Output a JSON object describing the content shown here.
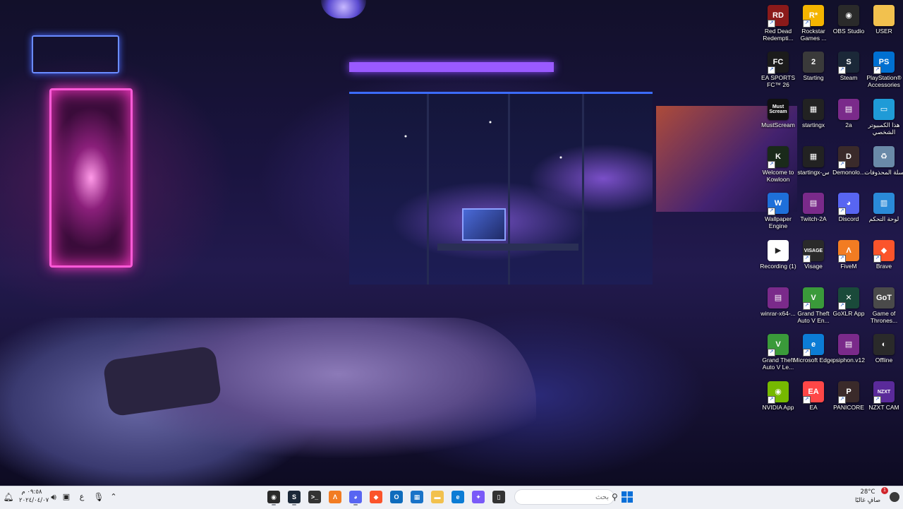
{
  "desktop": {
    "icons": [
      {
        "name": "red-dead-redemption-icon",
        "label": "Red Dead Redempti...",
        "glyph": "RD",
        "color": "#8b1a1a",
        "shortcut": true
      },
      {
        "name": "rockstar-games-icon",
        "label": "Rockstar Games ...",
        "glyph": "R*",
        "color": "#f4b400",
        "shortcut": true
      },
      {
        "name": "obs-studio-icon",
        "label": "OBS Studio",
        "glyph": "◉",
        "color": "#2a2a2a",
        "shortcut": false
      },
      {
        "name": "user-folder-icon",
        "label": "USER",
        "glyph": "",
        "color": "#f2c14e",
        "shortcut": false
      },
      {
        "name": "ea-sports-fc-icon",
        "label": "EA SPORTS FC™ 26",
        "glyph": "FC",
        "color": "#1b1b1b",
        "shortcut": true
      },
      {
        "name": "starting-icon",
        "label": "Starting",
        "glyph": "2",
        "color": "#3a3a3a",
        "shortcut": false
      },
      {
        "name": "steam-icon",
        "label": "Steam",
        "glyph": "S",
        "color": "#1b2838",
        "shortcut": true
      },
      {
        "name": "playstation-accessories-icon",
        "label": "PlayStation® Accessories",
        "glyph": "PS",
        "color": "#0070d1",
        "shortcut": true
      },
      {
        "name": "mustscream-icon",
        "label": "MustScream",
        "glyph": "Must Scream",
        "color": "#111111",
        "shortcut": false
      },
      {
        "name": "startingx-icon",
        "label": "startingx",
        "glyph": "▦",
        "color": "#222222",
        "shortcut": false
      },
      {
        "name": "2a-archive-icon",
        "label": "2a",
        "glyph": "▤",
        "color": "#7a2a8a",
        "shortcut": false
      },
      {
        "name": "this-pc-icon",
        "label": "هذا الكمبيوتر الشخصي",
        "glyph": "▭",
        "color": "#1f9bd7",
        "shortcut": false
      },
      {
        "name": "welcome-to-kowloon-icon",
        "label": "Welcome to Kowloon",
        "glyph": "K",
        "color": "#1a2a1a",
        "shortcut": true
      },
      {
        "name": "startingx-2-icon",
        "label": "startingx-س",
        "glyph": "▦",
        "color": "#222222",
        "shortcut": false
      },
      {
        "name": "demonologist-icon",
        "label": "Demonolo...",
        "glyph": "D",
        "color": "#3a2a2a",
        "shortcut": true
      },
      {
        "name": "recycle-bin-icon",
        "label": "سلة المحذوفات",
        "glyph": "♻",
        "color": "#6a8aa8",
        "shortcut": false
      },
      {
        "name": "wallpaper-engine-icon",
        "label": "Wallpaper Engine",
        "glyph": "W",
        "color": "#1e6fd9",
        "shortcut": true
      },
      {
        "name": "twitch-2a-icon",
        "label": "Twitch-2A",
        "glyph": "▤",
        "color": "#7a2a8a",
        "shortcut": false
      },
      {
        "name": "discord-icon",
        "label": "Discord",
        "glyph": "◕",
        "color": "#5865f2",
        "shortcut": true
      },
      {
        "name": "control-panel-icon",
        "label": "لوحة التحكم",
        "glyph": "▥",
        "color": "#2a8ad8",
        "shortcut": false
      },
      {
        "name": "recording-icon",
        "label": "Recording (1)",
        "glyph": "▶",
        "color": "#ffffff",
        "shortcut": false
      },
      {
        "name": "visage-icon",
        "label": "Visage",
        "glyph": "VISAGE",
        "color": "#2a2a2a",
        "shortcut": true
      },
      {
        "name": "fivem-icon",
        "label": "FiveM",
        "glyph": "Λ",
        "color": "#f27c22",
        "shortcut": true
      },
      {
        "name": "brave-icon",
        "label": "Brave",
        "glyph": "◆",
        "color": "#fb542b",
        "shortcut": true
      },
      {
        "name": "winrar-icon",
        "label": "winrar-x64-...",
        "glyph": "▤",
        "color": "#7a2a8a",
        "shortcut": false
      },
      {
        "name": "gta-v-enhanced-icon",
        "label": "Grand Theft Auto V En...",
        "glyph": "V",
        "color": "#3a9a3a",
        "shortcut": true
      },
      {
        "name": "goxlr-app-icon",
        "label": "GoXLR App",
        "glyph": "✕",
        "color": "#1a4a3a",
        "shortcut": true
      },
      {
        "name": "game-of-thrones-icon",
        "label": "Game of Thrones...",
        "glyph": "GoT",
        "color": "#4a4a4a",
        "shortcut": false
      },
      {
        "name": "gta-v-legacy-icon",
        "label": "Grand Theft Auto V Le...",
        "glyph": "V",
        "color": "#3a9a3a",
        "shortcut": true
      },
      {
        "name": "microsoft-edge-icon",
        "label": "Microsoft Edge",
        "glyph": "e",
        "color": "#0c7cd5",
        "shortcut": true
      },
      {
        "name": "psiphon-icon",
        "label": "psiphon.v12",
        "glyph": "▤",
        "color": "#7a2a8a",
        "shortcut": false
      },
      {
        "name": "offline-icon",
        "label": "Offline",
        "glyph": "◐",
        "color": "#2a2a2a",
        "shortcut": false
      },
      {
        "name": "nvidia-app-icon",
        "label": "NVIDIA App",
        "glyph": "◉",
        "color": "#76b900",
        "shortcut": true
      },
      {
        "name": "ea-app-icon",
        "label": "EA",
        "glyph": "EA",
        "color": "#ff4747",
        "shortcut": true
      },
      {
        "name": "panicore-icon",
        "label": "PANICORE",
        "glyph": "P",
        "color": "#3a2a2a",
        "shortcut": true
      },
      {
        "name": "nzxt-cam-icon",
        "label": "NZXT CAM",
        "glyph": "NZXT",
        "color": "#5a2a9a",
        "shortcut": true
      }
    ]
  },
  "taskbar": {
    "clock": {
      "time": "٠٩:٥٨ م",
      "date": "٢٠٢٤/٠٤/٠٧"
    },
    "search": {
      "placeholder": "بحث"
    },
    "weather": {
      "temp": "28°C",
      "desc": "صافٍ غالبًا",
      "badge": "1"
    },
    "tray": {
      "language": "ع"
    },
    "apps": [
      {
        "name": "obs-taskbar-icon",
        "glyph": "◉",
        "color": "#2a2a2a",
        "running": true
      },
      {
        "name": "steam-taskbar-icon",
        "glyph": "S",
        "color": "#1b2838",
        "running": true
      },
      {
        "name": "terminal-taskbar-icon",
        "glyph": ">_",
        "color": "#333333",
        "running": false
      },
      {
        "name": "fivem-taskbar-icon",
        "glyph": "Λ",
        "color": "#f27c22",
        "running": false
      },
      {
        "name": "discord-taskbar-icon",
        "glyph": "◕",
        "color": "#5865f2",
        "running": true
      },
      {
        "name": "brave-taskbar-icon",
        "glyph": "◆",
        "color": "#fb542b",
        "running": false
      },
      {
        "name": "outlook-taskbar-icon",
        "glyph": "O",
        "color": "#0f6cbd",
        "running": false
      },
      {
        "name": "store-taskbar-icon",
        "glyph": "▦",
        "color": "#1a73c8",
        "running": false
      },
      {
        "name": "file-explorer-taskbar-icon",
        "glyph": "▬",
        "color": "#f2c14e",
        "running": false
      },
      {
        "name": "edge-taskbar-icon",
        "glyph": "e",
        "color": "#0c7cd5",
        "running": false
      },
      {
        "name": "copilot-taskbar-icon",
        "glyph": "✦",
        "color": "#7a5af8",
        "running": false
      },
      {
        "name": "notepad-taskbar-icon",
        "glyph": "▯",
        "color": "#333333",
        "running": false
      }
    ]
  }
}
